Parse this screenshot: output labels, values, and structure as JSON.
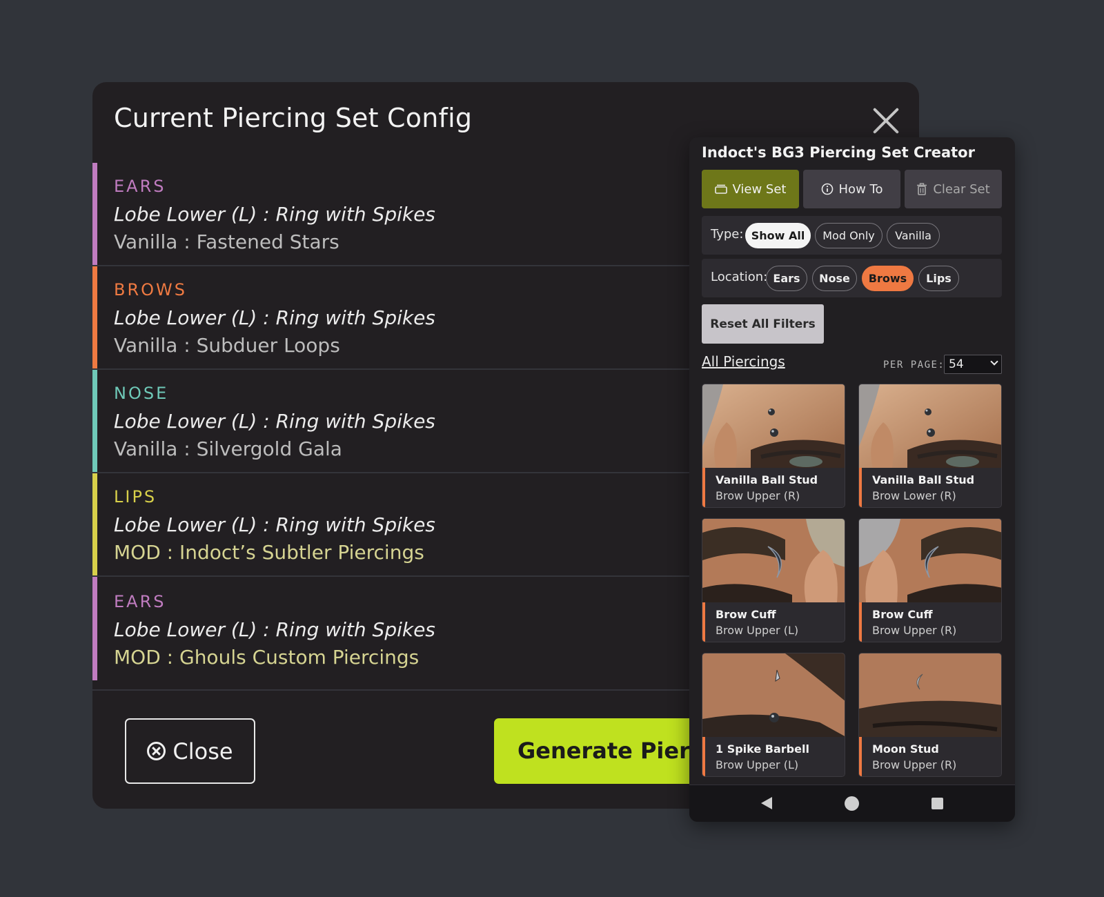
{
  "dialog": {
    "title": "Current Piercing Set Config",
    "entries": [
      {
        "category": "EARS",
        "line1": "Lobe Lower (L) : Ring with Spikes",
        "line2": "Vanilla : Fastened Stars",
        "color": "#c07cc0",
        "line2_color": "#bdbdbd"
      },
      {
        "category": "BROWS",
        "line1": "Lobe Lower (L) : Ring with Spikes",
        "line2": "Vanilla : Subduer Loops",
        "color": "#ef7a42",
        "line2_color": "#bdbdbd"
      },
      {
        "category": "NOSE",
        "line1": "Lobe Lower (L) : Ring with Spikes",
        "line2": "Vanilla : Silvergold Gala",
        "color": "#6fc9b8",
        "line2_color": "#bdbdbd"
      },
      {
        "category": "LIPS",
        "line1": "Lobe Lower (L) : Ring with Spikes",
        "line2": "MOD : Indoct’s Subtler Piercings",
        "color": "#d8d04a",
        "line2_color": "#d6d492"
      },
      {
        "category": "EARS",
        "line1": "Lobe Lower (L) : Ring with Spikes",
        "line2": "MOD : Ghouls Custom Piercings",
        "color": "#c07cc0",
        "line2_color": "#d6d492"
      }
    ],
    "close_label": "Close",
    "generate_label": "Generate Piercing Set"
  },
  "panel": {
    "title": "Indoct's BG3 Piercing Set Creator",
    "tabs": {
      "view_set": "View Set",
      "how_to": "How To",
      "clear_set": "Clear Set"
    },
    "type_filter": {
      "label": "Type:",
      "options": [
        "Show All",
        "Mod Only",
        "Vanilla"
      ],
      "selected": "Show All"
    },
    "location_filter": {
      "label": "Location:",
      "options": [
        "Ears",
        "Nose",
        "Brows",
        "Lips"
      ],
      "selected": "Brows"
    },
    "reset_label": "Reset All Filters",
    "list_title": "All Piercings",
    "per_page_label": "PER PAGE:",
    "per_page_value": "54",
    "cards": [
      {
        "name": "Vanilla Ball Stud",
        "location": "Brow Upper (R)"
      },
      {
        "name": "Vanilla Ball Stud",
        "location": "Brow Lower (R)"
      },
      {
        "name": "Brow Cuff",
        "location": "Brow Upper (L)"
      },
      {
        "name": "Brow Cuff",
        "location": "Brow Upper (R)"
      },
      {
        "name": "1 Spike Barbell",
        "location": "Brow Upper (L)"
      },
      {
        "name": "Moon Stud",
        "location": "Brow Upper (R)"
      }
    ]
  },
  "colors": {
    "accent_lime": "#bfe11f",
    "accent_orange": "#ef7942",
    "view_set_bg": "#6e7719"
  }
}
